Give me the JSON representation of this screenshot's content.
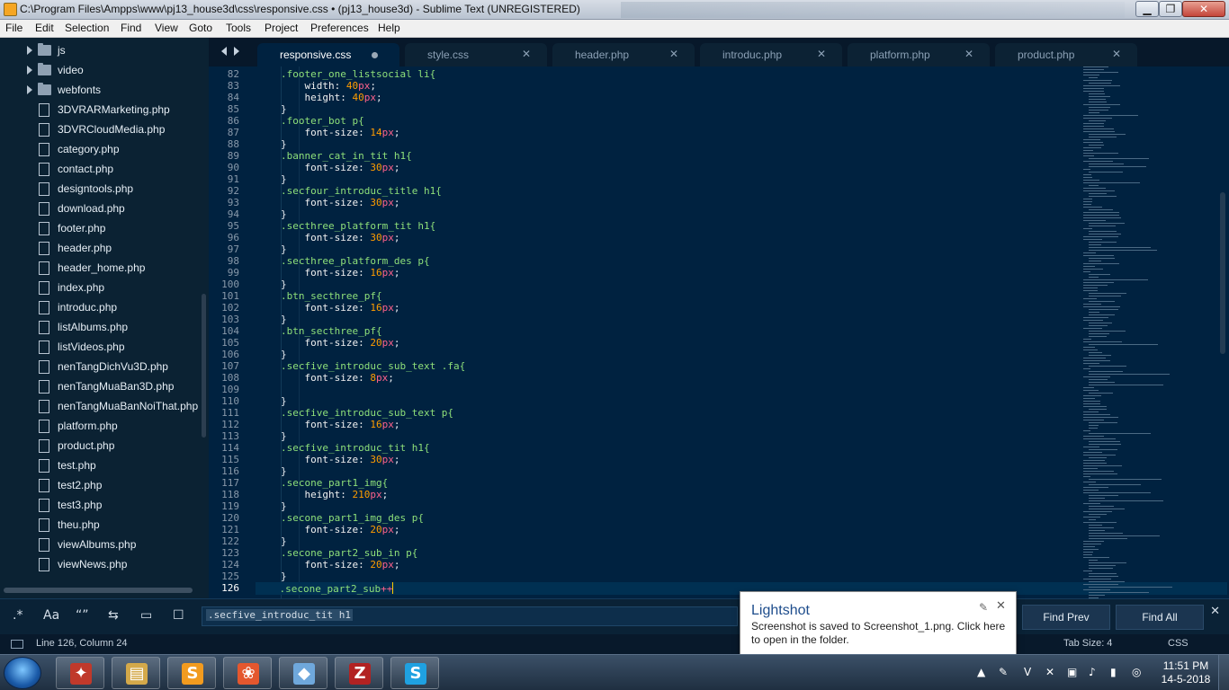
{
  "window": {
    "title": "C:\\Program Files\\Ampps\\www\\pj13_house3d\\css\\responsive.css • (pj13_house3d) - Sublime Text (UNREGISTERED)",
    "minimize": "▁",
    "maximize": "❐",
    "close": "✕"
  },
  "menu": [
    "File",
    "Edit",
    "Selection",
    "Find",
    "View",
    "Goto",
    "Tools",
    "Project",
    "Preferences",
    "Help"
  ],
  "sidebar": {
    "folders": [
      "js",
      "video",
      "webfonts"
    ],
    "files": [
      "3DVRARMarketing.php",
      "3DVRCloudMedia.php",
      "category.php",
      "contact.php",
      "designtools.php",
      "download.php",
      "footer.php",
      "header.php",
      "header_home.php",
      "index.php",
      "introduc.php",
      "listAlbums.php",
      "listVideos.php",
      "nenTangDichVu3D.php",
      "nenTangMuaBan3D.php",
      "nenTangMuaBanNoiThat.php",
      "platform.php",
      "product.php",
      "test.php",
      "test2.php",
      "test3.php",
      "theu.php",
      "viewAlbums.php",
      "viewNews.php"
    ]
  },
  "tabs": [
    {
      "label": "responsive.css",
      "active": true,
      "dirty": true
    },
    {
      "label": "style.css",
      "active": false
    },
    {
      "label": "header.php",
      "active": false
    },
    {
      "label": "introduc.php",
      "active": false
    },
    {
      "label": "platform.php",
      "active": false
    },
    {
      "label": "product.php",
      "active": false
    }
  ],
  "tab_close_glyph": "✕",
  "editor": {
    "lines": [
      {
        "n": "82",
        "t": "sel",
        "code": ".footer_one_listsocial li{"
      },
      {
        "n": "83",
        "t": "decl",
        "prop": "width: ",
        "num": "40",
        "unit": "px",
        "end": ";"
      },
      {
        "n": "84",
        "t": "decl",
        "prop": "height: ",
        "num": "40",
        "unit": "px",
        "end": ";"
      },
      {
        "n": "85",
        "t": "close",
        "code": "}"
      },
      {
        "n": "86",
        "t": "sel",
        "code": ".footer_bot p{"
      },
      {
        "n": "87",
        "t": "decl",
        "prop": "font-size: ",
        "num": "14",
        "unit": "px",
        "end": ";"
      },
      {
        "n": "88",
        "t": "close",
        "code": "}"
      },
      {
        "n": "89",
        "t": "sel",
        "code": ".banner_cat_in_tit h1{"
      },
      {
        "n": "90",
        "t": "decl",
        "prop": "font-size: ",
        "num": "30",
        "unit": "px",
        "end": ";"
      },
      {
        "n": "91",
        "t": "close",
        "code": "}"
      },
      {
        "n": "92",
        "t": "sel",
        "code": ".secfour_introduc_title h1{"
      },
      {
        "n": "93",
        "t": "decl",
        "prop": "font-size: ",
        "num": "30",
        "unit": "px",
        "end": ";"
      },
      {
        "n": "94",
        "t": "close",
        "code": "}"
      },
      {
        "n": "95",
        "t": "sel",
        "code": ".secthree_platform_tit h1{"
      },
      {
        "n": "96",
        "t": "decl",
        "prop": "font-size: ",
        "num": "30",
        "unit": "px",
        "end": ";"
      },
      {
        "n": "97",
        "t": "close",
        "code": "}"
      },
      {
        "n": "98",
        "t": "sel",
        "code": ".secthree_platform_des p{"
      },
      {
        "n": "99",
        "t": "decl",
        "prop": "font-size: ",
        "num": "16",
        "unit": "px",
        "end": ";"
      },
      {
        "n": "100",
        "t": "close",
        "code": "}"
      },
      {
        "n": "101",
        "t": "sel",
        "code": ".btn_secthree_pf{"
      },
      {
        "n": "102",
        "t": "decl",
        "prop": "font-size: ",
        "num": "16",
        "unit": "px",
        "end": ";"
      },
      {
        "n": "103",
        "t": "close",
        "code": "}"
      },
      {
        "n": "104",
        "t": "sel",
        "code": ".btn_secthree_pf{"
      },
      {
        "n": "105",
        "t": "decl",
        "prop": "font-size: ",
        "num": "20",
        "unit": "px",
        "end": ";"
      },
      {
        "n": "106",
        "t": "close",
        "code": "}"
      },
      {
        "n": "107",
        "t": "sel",
        "code": ".secfive_introduc_sub_text .fa{"
      },
      {
        "n": "108",
        "t": "decl",
        "prop": "font-size: ",
        "num": "8",
        "unit": "px",
        "end": ";"
      },
      {
        "n": "109",
        "t": "blank",
        "code": ""
      },
      {
        "n": "110",
        "t": "close",
        "code": "}"
      },
      {
        "n": "111",
        "t": "sel",
        "code": ".secfive_introduc_sub_text p{"
      },
      {
        "n": "112",
        "t": "decl",
        "prop": "font-size: ",
        "num": "16",
        "unit": "px",
        "end": ";"
      },
      {
        "n": "113",
        "t": "close",
        "code": "}"
      },
      {
        "n": "114",
        "t": "sel",
        "code": ".secfive_introduc_tit h1{"
      },
      {
        "n": "115",
        "t": "decl",
        "prop": "font-size: ",
        "num": "30",
        "unit": "px",
        "end": ";"
      },
      {
        "n": "116",
        "t": "close",
        "code": "}"
      },
      {
        "n": "117",
        "t": "sel",
        "code": ".secone_part1_img{"
      },
      {
        "n": "118",
        "t": "decl",
        "prop": "height: ",
        "num": "210",
        "unit": "px",
        "end": ";"
      },
      {
        "n": "119",
        "t": "close",
        "code": "}"
      },
      {
        "n": "120",
        "t": "sel",
        "code": ".secone_part1_img_des p{"
      },
      {
        "n": "121",
        "t": "decl",
        "prop": "font-size: ",
        "num": "20",
        "unit": "px",
        "end": ";"
      },
      {
        "n": "122",
        "t": "close",
        "code": "}"
      },
      {
        "n": "123",
        "t": "sel",
        "code": ".secone_part2_sub_in p{"
      },
      {
        "n": "124",
        "t": "decl",
        "prop": "font-size: ",
        "num": "20",
        "unit": "px",
        "end": ";"
      },
      {
        "n": "125",
        "t": "close",
        "code": "}"
      },
      {
        "n": "126",
        "t": "cursor",
        "code": ".secone_part2_sub",
        "tail": "++"
      }
    ]
  },
  "find": {
    "options": [
      ".*",
      "Aa",
      "“”",
      "⇆",
      "▭",
      "☐"
    ],
    "query": ".secfive_introduc_tit h1",
    "find_prev": "Find Prev",
    "find_all": "Find All",
    "close": "✕"
  },
  "status": {
    "position": "Line 126, Column 24",
    "tab_size": "Tab Size: 4",
    "syntax": "CSS"
  },
  "notification": {
    "title": "Lightshot",
    "body": "Screenshot is saved to Screenshot_1.png. Click here to open in the folder.",
    "close": "✕",
    "pin": "✎"
  },
  "taskbar": {
    "apps": [
      {
        "name": "app-1",
        "glyph": "✦",
        "color": "#c0392b"
      },
      {
        "name": "explorer",
        "glyph": "▤",
        "color": "#d4a94a"
      },
      {
        "name": "sublime",
        "glyph": "S",
        "color": "#f29b1f"
      },
      {
        "name": "app-4",
        "glyph": "❀",
        "color": "#e4572e"
      },
      {
        "name": "app-5",
        "glyph": "◆",
        "color": "#6fa8dc"
      },
      {
        "name": "filezilla",
        "glyph": "Z",
        "color": "#b22222"
      },
      {
        "name": "skype",
        "glyph": "S",
        "color": "#1fa1e1"
      }
    ],
    "tray_icons": [
      "▲",
      "✎",
      "V",
      "✕",
      "▣",
      "♪",
      "▮",
      "◎"
    ],
    "time": "11:51 PM",
    "date": "14-5-2018"
  }
}
